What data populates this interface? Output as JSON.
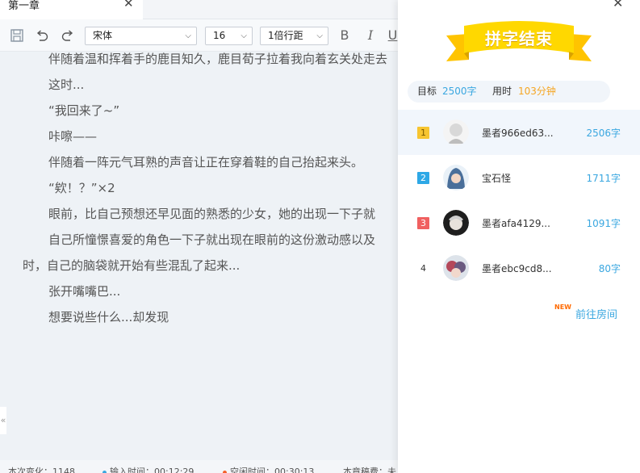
{
  "tab": {
    "title": "第一章"
  },
  "toolbar": {
    "font_family": "宋体",
    "font_size": "16",
    "line_spacing": "1倍行距",
    "bold": "B",
    "italic": "I",
    "underline": "U"
  },
  "editor": {
    "lines": [
      "伴随着温和挥着手的鹿目知久，鹿目荀子拉着我向着玄关处走去",
      "这时...",
      "“我回来了~”",
      "咔嚓——",
      "伴随着一阵元气耳熟的声音让正在穿着鞋的自己抬起来头。",
      "“欸！？”×2",
      "眼前，比自己预想还早见面的熟悉的少女，她的出现一下子就",
      "自己所憧憬喜爱的角色一下子就出现在眼前的这份激动感以及",
      "时，自己的脑袋就开始有些混乱了起来...",
      "张开嘴嘴巴...",
      "想要说些什么...却发现"
    ]
  },
  "status": {
    "change": "本次变化：1148",
    "input_time": "输入时间：00:12:29",
    "idle_time": "空闲时间：00:30:13",
    "chapter": "本章稿费：未"
  },
  "panel": {
    "banner": "拼字结束",
    "target_label": "目标",
    "target_value": "2500字",
    "time_label": "用时",
    "time_value": "103分钟",
    "ranking": [
      {
        "rank": "1",
        "name": "墨者966ed63...",
        "count": "2506字"
      },
      {
        "rank": "2",
        "name": "宝石怪",
        "count": "1711字"
      },
      {
        "rank": "3",
        "name": "墨者afa4129...",
        "count": "1091字"
      },
      {
        "rank": "4",
        "name": "墨者ebc9cd8...",
        "count": "80字"
      }
    ],
    "new_badge": "NEW",
    "enter_room": "前往房间"
  },
  "colors": {
    "accent_blue": "#3aa7e0",
    "accent_orange": "#f5a623",
    "rank1": "#f7c531",
    "rank2": "#2ea8e6",
    "rank3": "#f06060",
    "ribbon": "#ffd400"
  }
}
